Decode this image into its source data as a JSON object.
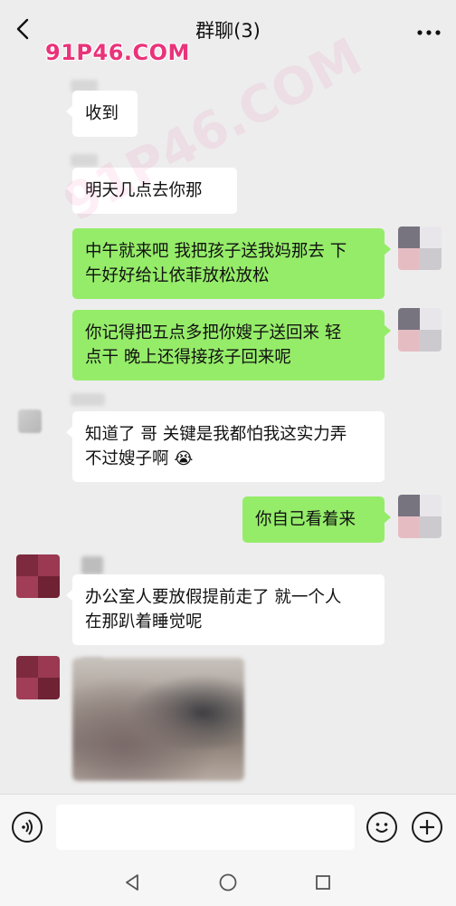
{
  "header": {
    "title": "群聊(3)",
    "back_icon": "chevron-left-icon",
    "more_icon": "ellipsis-icon"
  },
  "watermark": {
    "text": "91P46.COM",
    "color": "#e9337a"
  },
  "messages": [
    {
      "side": "in",
      "text": "收到"
    },
    {
      "side": "in",
      "text": "明天几点去你那"
    },
    {
      "side": "out",
      "line1": "中午就来吧 我把孩子送我妈那去 下",
      "line2": "午好好给让依菲放松放松"
    },
    {
      "side": "out",
      "line1": "你记得把五点多把你嫂子送回来 轻",
      "line2": "点干 晚上还得接孩子回来呢"
    },
    {
      "side": "in",
      "line1": "知道了 哥 关键是我都怕我这实力弄",
      "line2": "不过嫂子啊",
      "emoji": "😭"
    },
    {
      "side": "out",
      "text": "你自己看着来"
    },
    {
      "side": "in",
      "line1": "办公室人要放假提前走了 就一个人",
      "line2": "在那趴着睡觉呢"
    }
  ],
  "input": {
    "placeholder": "",
    "voice_icon": "voice-icon",
    "emoji_icon": "smiley-icon",
    "plus_icon": "plus-icon"
  },
  "navbar": {
    "back_icon": "triangle-back-icon",
    "home_icon": "circle-home-icon",
    "recent_icon": "square-recents-icon"
  },
  "colors": {
    "background": "#ededed",
    "outgoing_bubble": "#95ec69",
    "incoming_bubble": "#ffffff"
  }
}
